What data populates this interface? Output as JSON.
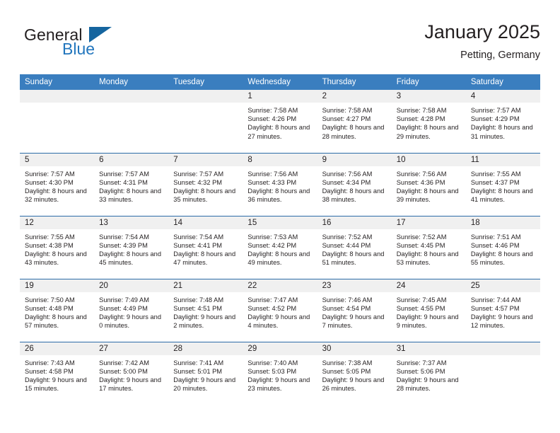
{
  "brand": {
    "name_part1": "General",
    "name_part2": "Blue",
    "logo_icon": "blue-triangle-icon"
  },
  "header": {
    "month_title": "January 2025",
    "location": "Petting, Germany"
  },
  "colors": {
    "header_blue": "#3a7ebf",
    "row_divider_blue": "#2c6ca8",
    "daynum_band": "#f0f0f0",
    "brand_blue": "#2276bd",
    "logo_blue": "#15659f",
    "text": "#231f20"
  },
  "weekday_headers": [
    "Sunday",
    "Monday",
    "Tuesday",
    "Wednesday",
    "Thursday",
    "Friday",
    "Saturday"
  ],
  "weeks": [
    [
      {
        "day": "",
        "blank": true
      },
      {
        "day": "",
        "blank": true
      },
      {
        "day": "",
        "blank": true
      },
      {
        "day": "1",
        "sunrise": "Sunrise: 7:58 AM",
        "sunset": "Sunset: 4:26 PM",
        "daylight": "Daylight: 8 hours and 27 minutes."
      },
      {
        "day": "2",
        "sunrise": "Sunrise: 7:58 AM",
        "sunset": "Sunset: 4:27 PM",
        "daylight": "Daylight: 8 hours and 28 minutes."
      },
      {
        "day": "3",
        "sunrise": "Sunrise: 7:58 AM",
        "sunset": "Sunset: 4:28 PM",
        "daylight": "Daylight: 8 hours and 29 minutes."
      },
      {
        "day": "4",
        "sunrise": "Sunrise: 7:57 AM",
        "sunset": "Sunset: 4:29 PM",
        "daylight": "Daylight: 8 hours and 31 minutes."
      }
    ],
    [
      {
        "day": "5",
        "sunrise": "Sunrise: 7:57 AM",
        "sunset": "Sunset: 4:30 PM",
        "daylight": "Daylight: 8 hours and 32 minutes."
      },
      {
        "day": "6",
        "sunrise": "Sunrise: 7:57 AM",
        "sunset": "Sunset: 4:31 PM",
        "daylight": "Daylight: 8 hours and 33 minutes."
      },
      {
        "day": "7",
        "sunrise": "Sunrise: 7:57 AM",
        "sunset": "Sunset: 4:32 PM",
        "daylight": "Daylight: 8 hours and 35 minutes."
      },
      {
        "day": "8",
        "sunrise": "Sunrise: 7:56 AM",
        "sunset": "Sunset: 4:33 PM",
        "daylight": "Daylight: 8 hours and 36 minutes."
      },
      {
        "day": "9",
        "sunrise": "Sunrise: 7:56 AM",
        "sunset": "Sunset: 4:34 PM",
        "daylight": "Daylight: 8 hours and 38 minutes."
      },
      {
        "day": "10",
        "sunrise": "Sunrise: 7:56 AM",
        "sunset": "Sunset: 4:36 PM",
        "daylight": "Daylight: 8 hours and 39 minutes."
      },
      {
        "day": "11",
        "sunrise": "Sunrise: 7:55 AM",
        "sunset": "Sunset: 4:37 PM",
        "daylight": "Daylight: 8 hours and 41 minutes."
      }
    ],
    [
      {
        "day": "12",
        "sunrise": "Sunrise: 7:55 AM",
        "sunset": "Sunset: 4:38 PM",
        "daylight": "Daylight: 8 hours and 43 minutes."
      },
      {
        "day": "13",
        "sunrise": "Sunrise: 7:54 AM",
        "sunset": "Sunset: 4:39 PM",
        "daylight": "Daylight: 8 hours and 45 minutes."
      },
      {
        "day": "14",
        "sunrise": "Sunrise: 7:54 AM",
        "sunset": "Sunset: 4:41 PM",
        "daylight": "Daylight: 8 hours and 47 minutes."
      },
      {
        "day": "15",
        "sunrise": "Sunrise: 7:53 AM",
        "sunset": "Sunset: 4:42 PM",
        "daylight": "Daylight: 8 hours and 49 minutes."
      },
      {
        "day": "16",
        "sunrise": "Sunrise: 7:52 AM",
        "sunset": "Sunset: 4:44 PM",
        "daylight": "Daylight: 8 hours and 51 minutes."
      },
      {
        "day": "17",
        "sunrise": "Sunrise: 7:52 AM",
        "sunset": "Sunset: 4:45 PM",
        "daylight": "Daylight: 8 hours and 53 minutes."
      },
      {
        "day": "18",
        "sunrise": "Sunrise: 7:51 AM",
        "sunset": "Sunset: 4:46 PM",
        "daylight": "Daylight: 8 hours and 55 minutes."
      }
    ],
    [
      {
        "day": "19",
        "sunrise": "Sunrise: 7:50 AM",
        "sunset": "Sunset: 4:48 PM",
        "daylight": "Daylight: 8 hours and 57 minutes."
      },
      {
        "day": "20",
        "sunrise": "Sunrise: 7:49 AM",
        "sunset": "Sunset: 4:49 PM",
        "daylight": "Daylight: 9 hours and 0 minutes."
      },
      {
        "day": "21",
        "sunrise": "Sunrise: 7:48 AM",
        "sunset": "Sunset: 4:51 PM",
        "daylight": "Daylight: 9 hours and 2 minutes."
      },
      {
        "day": "22",
        "sunrise": "Sunrise: 7:47 AM",
        "sunset": "Sunset: 4:52 PM",
        "daylight": "Daylight: 9 hours and 4 minutes."
      },
      {
        "day": "23",
        "sunrise": "Sunrise: 7:46 AM",
        "sunset": "Sunset: 4:54 PM",
        "daylight": "Daylight: 9 hours and 7 minutes."
      },
      {
        "day": "24",
        "sunrise": "Sunrise: 7:45 AM",
        "sunset": "Sunset: 4:55 PM",
        "daylight": "Daylight: 9 hours and 9 minutes."
      },
      {
        "day": "25",
        "sunrise": "Sunrise: 7:44 AM",
        "sunset": "Sunset: 4:57 PM",
        "daylight": "Daylight: 9 hours and 12 minutes."
      }
    ],
    [
      {
        "day": "26",
        "sunrise": "Sunrise: 7:43 AM",
        "sunset": "Sunset: 4:58 PM",
        "daylight": "Daylight: 9 hours and 15 minutes."
      },
      {
        "day": "27",
        "sunrise": "Sunrise: 7:42 AM",
        "sunset": "Sunset: 5:00 PM",
        "daylight": "Daylight: 9 hours and 17 minutes."
      },
      {
        "day": "28",
        "sunrise": "Sunrise: 7:41 AM",
        "sunset": "Sunset: 5:01 PM",
        "daylight": "Daylight: 9 hours and 20 minutes."
      },
      {
        "day": "29",
        "sunrise": "Sunrise: 7:40 AM",
        "sunset": "Sunset: 5:03 PM",
        "daylight": "Daylight: 9 hours and 23 minutes."
      },
      {
        "day": "30",
        "sunrise": "Sunrise: 7:38 AM",
        "sunset": "Sunset: 5:05 PM",
        "daylight": "Daylight: 9 hours and 26 minutes."
      },
      {
        "day": "31",
        "sunrise": "Sunrise: 7:37 AM",
        "sunset": "Sunset: 5:06 PM",
        "daylight": "Daylight: 9 hours and 28 minutes."
      },
      {
        "day": "",
        "blank": true
      }
    ]
  ]
}
